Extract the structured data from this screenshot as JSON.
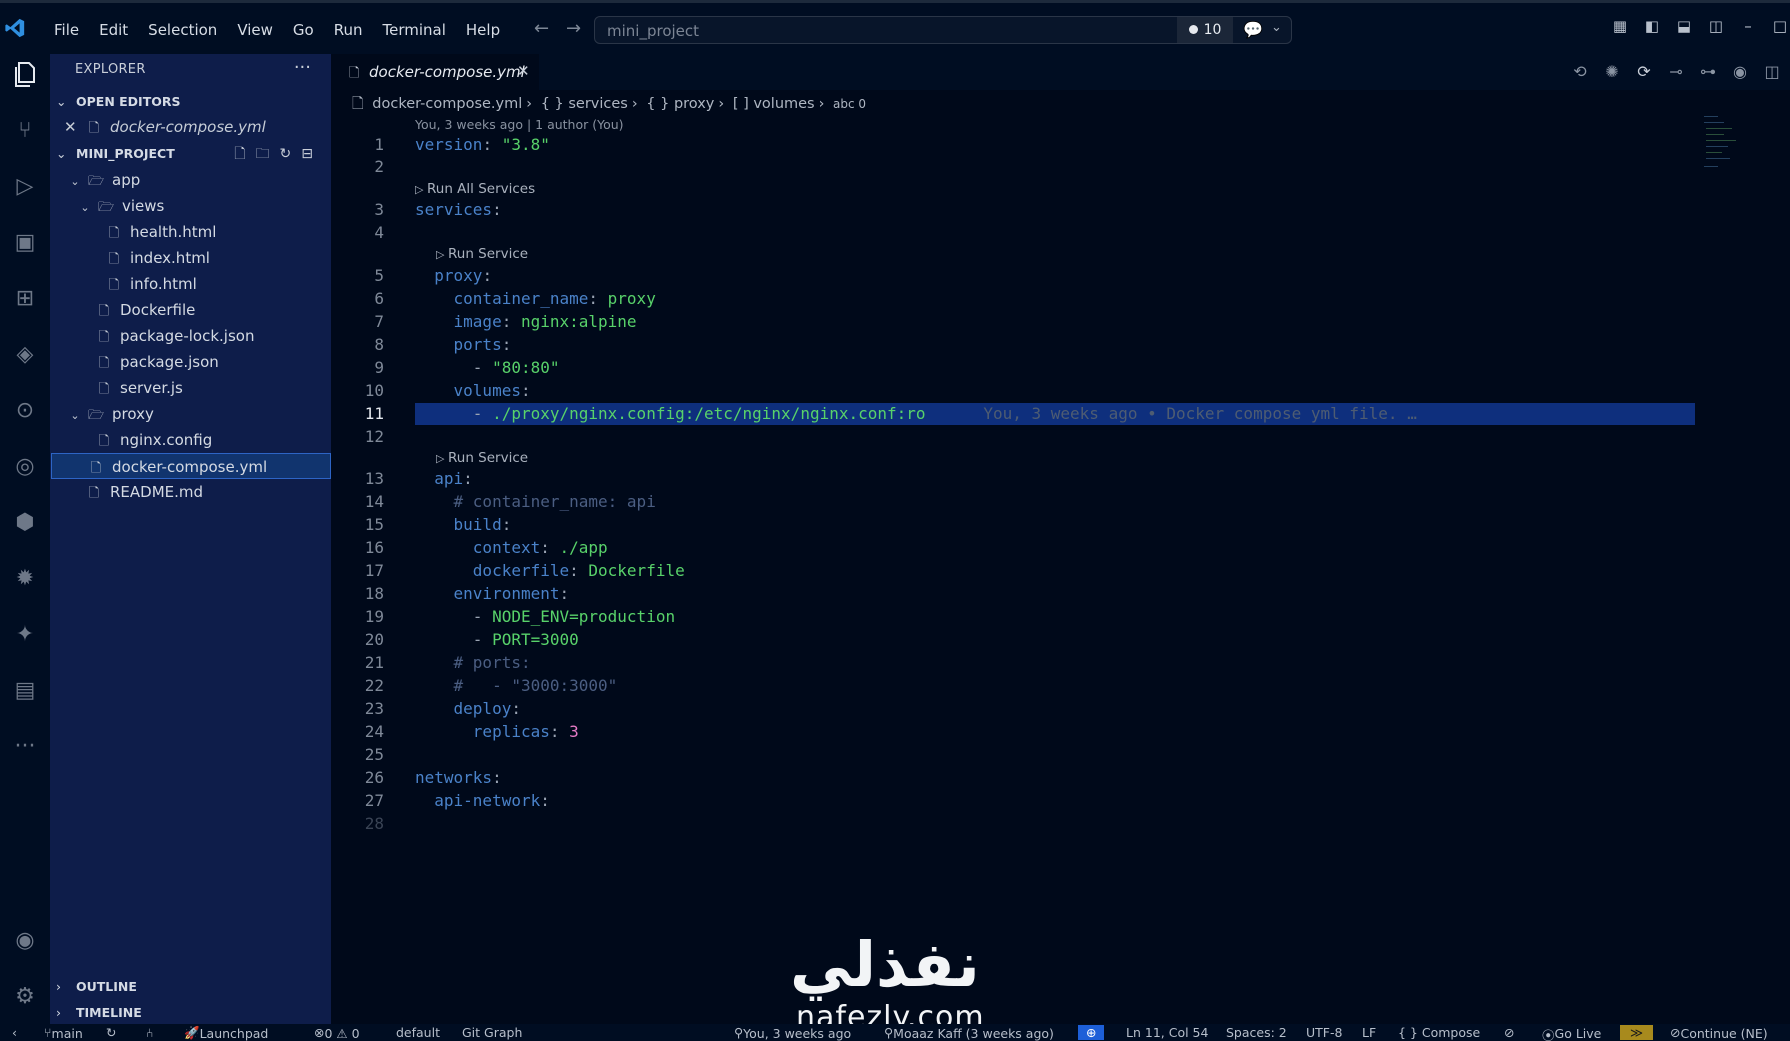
{
  "menu": [
    "File",
    "Edit",
    "Selection",
    "View",
    "Go",
    "Run",
    "Terminal",
    "Help"
  ],
  "command_center": {
    "text": "mini_project",
    "badge_count": "10"
  },
  "sidebar": {
    "title": "EXPLORER",
    "more": "···",
    "open_editors": {
      "label": "OPEN EDITORS",
      "files": [
        "docker-compose.yml"
      ]
    },
    "project": {
      "label": "MINI_PROJECT",
      "tree": [
        {
          "name": "app",
          "type": "folder",
          "depth": 0
        },
        {
          "name": "views",
          "type": "folder",
          "depth": 1
        },
        {
          "name": "health.html",
          "type": "file",
          "depth": 2
        },
        {
          "name": "index.html",
          "type": "file",
          "depth": 2
        },
        {
          "name": "info.html",
          "type": "file",
          "depth": 2
        },
        {
          "name": "Dockerfile",
          "type": "file",
          "depth": 1
        },
        {
          "name": "package-lock.json",
          "type": "file",
          "depth": 1
        },
        {
          "name": "package.json",
          "type": "file",
          "depth": 1
        },
        {
          "name": "server.js",
          "type": "file",
          "depth": 1
        },
        {
          "name": "proxy",
          "type": "folder",
          "depth": 0
        },
        {
          "name": "nginx.config",
          "type": "file",
          "depth": 1
        },
        {
          "name": "docker-compose.yml",
          "type": "file",
          "depth": 0,
          "selected": true
        },
        {
          "name": "README.md",
          "type": "file",
          "depth": 0
        }
      ]
    },
    "outline": "OUTLINE",
    "timeline": "TIMELINE"
  },
  "tab": {
    "name": "docker-compose.yml"
  },
  "breadcrumb": [
    "docker-compose.yml",
    "{ } services",
    "{ } proxy",
    "[ ] volumes",
    "abc 0"
  ],
  "blame_top": "You, 3 weeks ago | 1 author (You)",
  "code_lens": {
    "run_all": "Run All Services",
    "run_service": "Run Service"
  },
  "code": {
    "l1_key": "version",
    "l1_val": "\"3.8\"",
    "l3_key": "services",
    "l5_key": "proxy",
    "l6_key": "container_name",
    "l6_val": "proxy",
    "l7_key": "image",
    "l7_val": "nginx:alpine",
    "l8_key": "ports",
    "l9_val": "\"80:80\"",
    "l10_key": "volumes",
    "l11_val": "./proxy/nginx.config:/etc/nginx/nginx.conf:ro",
    "l11_blame": "You, 3 weeks ago • Docker compose yml file. …",
    "l13_key": "api",
    "l14_comment": "# container_name: api",
    "l15_key": "build",
    "l16_key": "context",
    "l16_val": "./app",
    "l17_key": "dockerfile",
    "l17_val": "Dockerfile",
    "l18_key": "environment",
    "l19_val": "NODE_ENV=production",
    "l20_val": "PORT=3000",
    "l21_comment": "# ports:",
    "l22_comment": "#   - \"3000:3000\"",
    "l23_key": "deploy",
    "l24_key": "replicas",
    "l24_val": "3",
    "l26_key": "networks",
    "l27_key": "api-network"
  },
  "status": {
    "branch": "main",
    "launchpad": "Launchpad",
    "problems": "0 ⚠ 0",
    "profile": "default",
    "git_graph": "Git Graph",
    "blame": "You, 3 weeks ago",
    "author": "Moaaz Kaff (3 weeks ago)",
    "cursor": "Ln 11, Col 54",
    "spaces": "Spaces: 2",
    "encoding": "UTF-8",
    "eol": "LF",
    "language": "{ } Compose",
    "go_live": "Go Live",
    "continue": "Continue (NE)"
  },
  "watermark": {
    "arabic": "نفذلي",
    "latin": "nafezly.com"
  }
}
